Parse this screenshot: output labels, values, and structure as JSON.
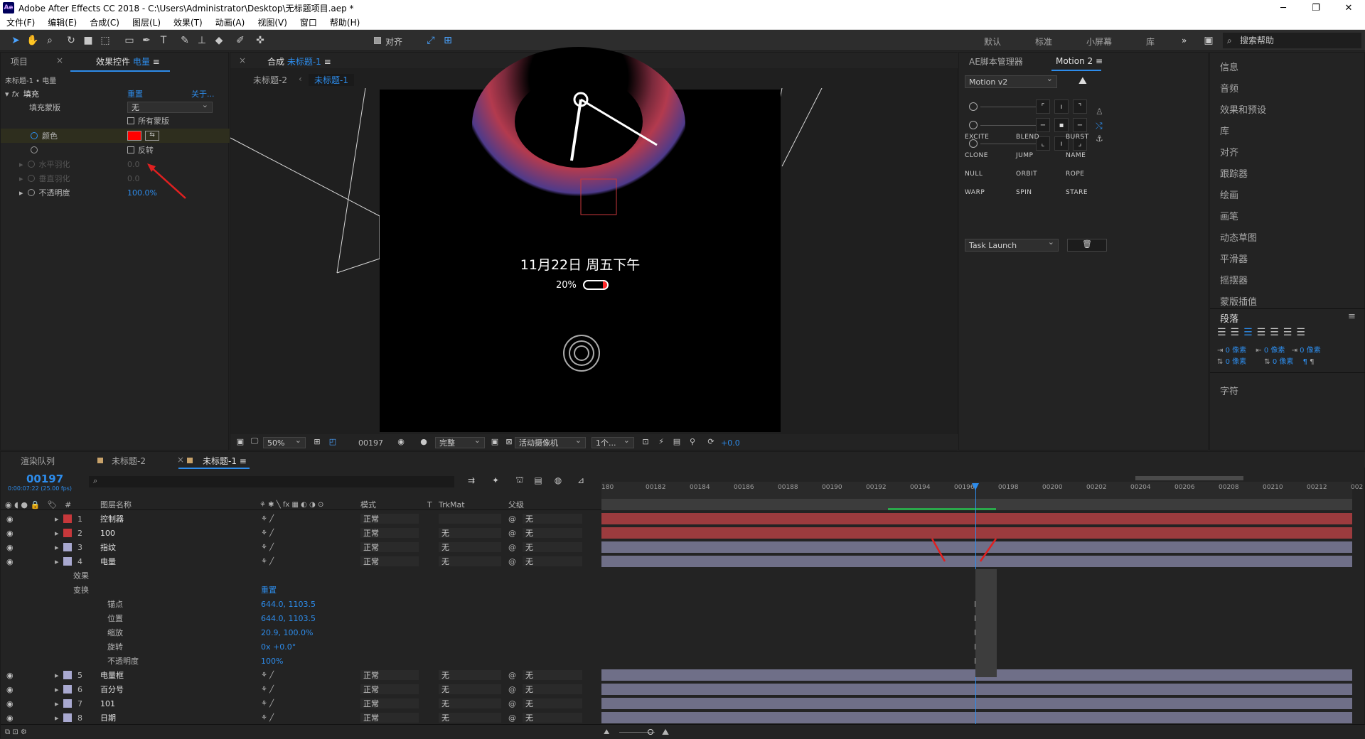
{
  "window": {
    "title": "Adobe After Effects CC 2018 - C:\\Users\\Administrator\\Desktop\\无标题项目.aep *",
    "app_icon": "Ae",
    "minimize": "─",
    "maximize": "❐",
    "close": "✕"
  },
  "menu": [
    "文件(F)",
    "编辑(E)",
    "合成(C)",
    "图层(L)",
    "效果(T)",
    "动画(A)",
    "视图(V)",
    "窗口",
    "帮助(H)"
  ],
  "toolbar": {
    "align_label": "对齐",
    "workspaces": [
      "默认",
      "标准",
      "小屏幕",
      "库"
    ],
    "more": "»",
    "search_placeholder": "搜索帮助"
  },
  "effect_panel": {
    "tab_project": "项目",
    "tab_effects": "效果控件",
    "tab_effects_layer": "电量",
    "breadcrumb": "未标题-1 • 电量",
    "effect_name": "填充",
    "reset": "重置",
    "about": "关于...",
    "fill_mask_label": "填充蒙版",
    "fill_mask_value": "无",
    "all_masks": "所有蒙版",
    "color_label": "颜色",
    "invert": "反转",
    "h_feather": "水平羽化",
    "v_feather": "垂直羽化",
    "feather_value": "0.0",
    "opacity_label": "不透明度",
    "opacity_value": "100.0%"
  },
  "comp_panel": {
    "tab_prefix": "合成",
    "tab_name": "未标题-1",
    "crumb1": "未标题-2",
    "crumb2": "未标题-1",
    "date_text": "11月22日 周五下午",
    "battery_percent": "20%",
    "battery_level": 0.2,
    "zoom": "50%",
    "frame": "00197",
    "quality": "完整",
    "camera": "活动摄像机",
    "views": "1个...",
    "exposure": "+0.0"
  },
  "motion_panel": {
    "tab_scripts": "AE脚本管理器",
    "tab_motion": "Motion 2",
    "version_dropdown": "Motion v2",
    "buttons": [
      "EXCITE",
      "BLEND",
      "BURST",
      "CLONE",
      "JUMP",
      "NAME",
      "NULL",
      "ORBIT",
      "ROPE",
      "WARP",
      "SPIN",
      "STARE"
    ],
    "task_dropdown": "Task Launch"
  },
  "right_panels": {
    "items": [
      "信息",
      "音频",
      "效果和预设",
      "库",
      "对齐",
      "跟踪器",
      "绘画",
      "画笔",
      "动态草图",
      "平滑器",
      "摇摆器",
      "蒙版插值"
    ],
    "paragraph_title": "段落",
    "px_labels": [
      "0 像素",
      "0 像素",
      "0 像素",
      "0 像素",
      "0 像素"
    ],
    "character_title": "字符"
  },
  "timeline": {
    "tab_render": "渲染队列",
    "tab_comp2": "未标题-2",
    "tab_comp1": "未标题-1",
    "timecode": "00197",
    "timecode_sub": "0:00:07:22 (25.00 fps)",
    "col_name": "图层名称",
    "col_mode": "模式",
    "col_t": "T",
    "col_trkmat": "TrkMat",
    "col_parent": "父级",
    "ruler": [
      "180",
      "00182",
      "00184",
      "00186",
      "00188",
      "00190",
      "00192",
      "00194",
      "00196",
      "00198",
      "00200",
      "00202",
      "00204",
      "00206",
      "00208",
      "00210",
      "00212",
      "002"
    ],
    "layers": [
      {
        "num": "1",
        "name": "控制器",
        "mode": "正常",
        "trk": "",
        "parent": "无",
        "color": "#c7383b",
        "type": "solid"
      },
      {
        "num": "2",
        "name": "100",
        "mode": "正常",
        "trk": "无",
        "parent": "无",
        "color": "#c7383b",
        "type": "text"
      },
      {
        "num": "3",
        "name": "指纹",
        "mode": "正常",
        "trk": "无",
        "parent": "无",
        "color": "#a9a9d0",
        "type": "shape"
      },
      {
        "num": "4",
        "name": "电量",
        "mode": "正常",
        "trk": "无",
        "parent": "无",
        "color": "#a9a9d0",
        "type": "shape"
      }
    ],
    "sub_effects": "效果",
    "sub_transform": "变换",
    "sub_reset": "重置",
    "props": [
      {
        "name": "锚点",
        "value": "644.0, 1103.5"
      },
      {
        "name": "位置",
        "value": "644.0, 1103.5"
      },
      {
        "name": "缩放",
        "value": "20.9, 100.0%"
      },
      {
        "name": "旋转",
        "value": "0x +0.0°"
      },
      {
        "name": "不透明度",
        "value": "100%"
      }
    ],
    "layers2": [
      {
        "num": "5",
        "name": "电量框",
        "mode": "正常",
        "trk": "无",
        "parent": "无",
        "color": "#a9a9d0"
      },
      {
        "num": "6",
        "name": "百分号",
        "mode": "正常",
        "trk": "无",
        "parent": "无",
        "color": "#a9a9d0"
      },
      {
        "num": "7",
        "name": "101",
        "mode": "正常",
        "trk": "无",
        "parent": "无",
        "color": "#a9a9d0"
      },
      {
        "num": "8",
        "name": "日期",
        "mode": "正常",
        "trk": "无",
        "parent": "无",
        "color": "#a9a9d0"
      }
    ]
  }
}
